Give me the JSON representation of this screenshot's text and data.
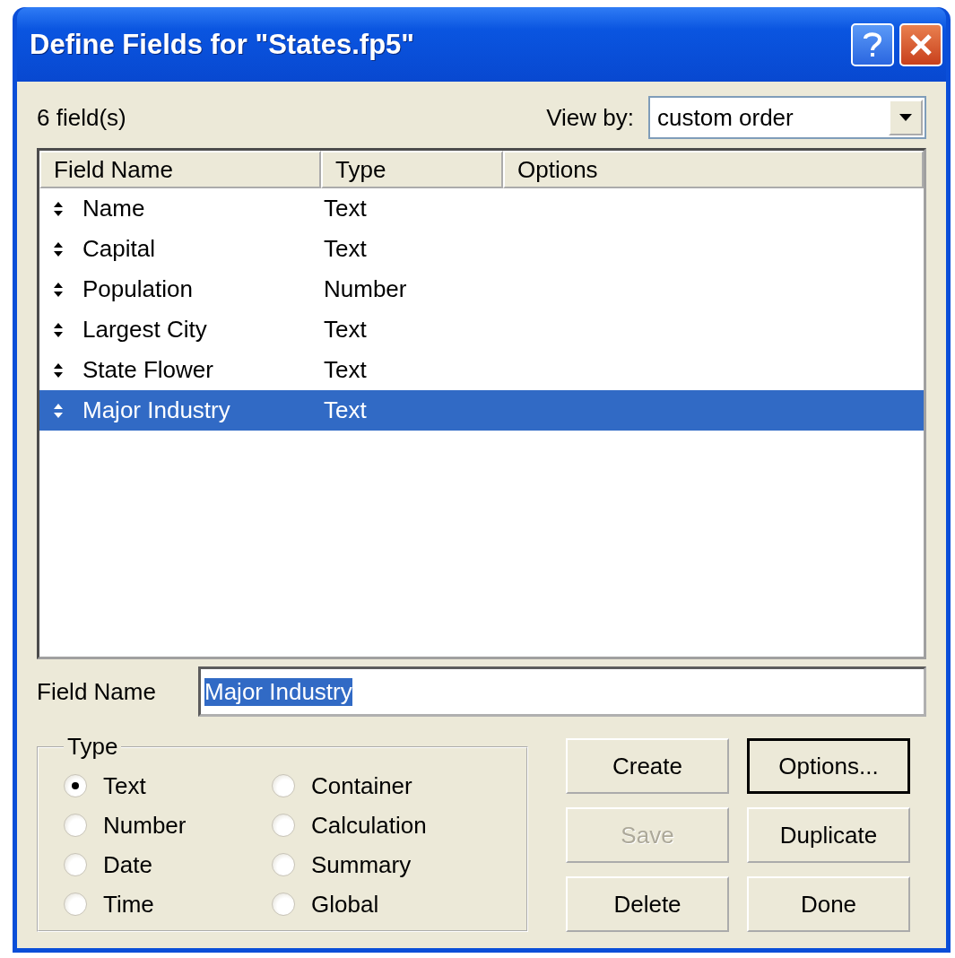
{
  "window": {
    "title": "Define Fields for \"States.fp5\""
  },
  "field_count": "6 field(s)",
  "view_by": {
    "label": "View by:",
    "value": "custom order"
  },
  "table": {
    "columns": [
      "Field Name",
      "Type",
      "Options"
    ],
    "rows": [
      {
        "name": "Name",
        "type": "Text",
        "selected": false
      },
      {
        "name": "Capital",
        "type": "Text",
        "selected": false
      },
      {
        "name": "Population",
        "type": "Number",
        "selected": false
      },
      {
        "name": "Largest City",
        "type": "Text",
        "selected": false
      },
      {
        "name": "State Flower",
        "type": "Text",
        "selected": false
      },
      {
        "name": "Major Industry",
        "type": "Text",
        "selected": true
      }
    ]
  },
  "field_name": {
    "label": "Field Name",
    "value": "Major Industry",
    "text_selected": true
  },
  "type_group": {
    "title": "Type",
    "options": [
      {
        "label": "Text",
        "selected": true
      },
      {
        "label": "Number",
        "selected": false
      },
      {
        "label": "Date",
        "selected": false
      },
      {
        "label": "Time",
        "selected": false
      },
      {
        "label": "Container",
        "selected": false
      },
      {
        "label": "Calculation",
        "selected": false
      },
      {
        "label": "Summary",
        "selected": false
      },
      {
        "label": "Global",
        "selected": false
      }
    ]
  },
  "buttons": [
    {
      "label": "Create",
      "disabled": false,
      "default": false
    },
    {
      "label": "Options...",
      "disabled": false,
      "default": true
    },
    {
      "label": "Save",
      "disabled": true,
      "default": false
    },
    {
      "label": "Duplicate",
      "disabled": false,
      "default": false
    },
    {
      "label": "Delete",
      "disabled": false,
      "default": false
    },
    {
      "label": "Done",
      "disabled": false,
      "default": false
    }
  ]
}
